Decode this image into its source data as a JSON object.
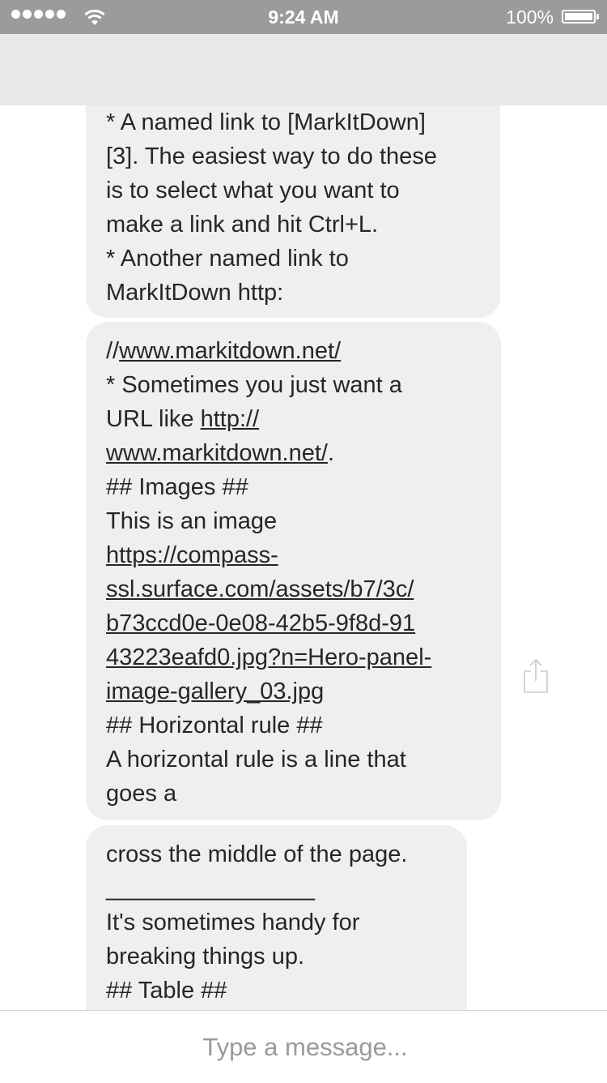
{
  "status_bar": {
    "time": "9:24 AM",
    "battery": "100%",
    "signal_icon": "signal-dots-icon",
    "wifi_icon": "wifi-icon",
    "battery_icon": "battery-icon"
  },
  "colors": {
    "status_bar_bg": "#9b9b9b",
    "nav_bar_bg": "#e8e8e8",
    "bubble_bg": "#efefef",
    "text": "#262626",
    "placeholder": "#9a9a9a"
  },
  "messages": [
    {
      "lines": [
        "* A named link to [MarkItDown]",
        "[3]. The easiest way to do these",
        "is to select what you want to",
        "make a link and hit Ctrl+L.",
        "* Another named link to",
        "MarkItDown http:"
      ]
    },
    {
      "line1_prefix": "//",
      "line1_link": "www.markitdown.net/",
      "line2": "* Sometimes you just want a",
      "line3_prefix": "URL like ",
      "line3_link": "http://",
      "line4_link": "www.markitdown.net/",
      "line4_suffix": ".",
      "line5": "## Images ##",
      "line6": "This is an image",
      "image_link_lines": [
        "https://compass-",
        "ssl.surface.com/assets/b7/3c/",
        "b73ccd0e-0e08-42b5-9f8d-91",
        "43223eafd0.jpg?n=Hero-panel-",
        "image-gallery_03.jpg"
      ],
      "line12": "## Horizontal rule ##",
      "line13": "A horizontal rule is a line that",
      "line14": "goes a"
    },
    {
      "lines": [
        "cross the middle of the page.",
        "________________",
        "It's sometimes handy for",
        "breaking things up.",
        "## Table ##"
      ]
    }
  ],
  "share_icon": "share-icon",
  "composer": {
    "placeholder": "Type a message..."
  }
}
